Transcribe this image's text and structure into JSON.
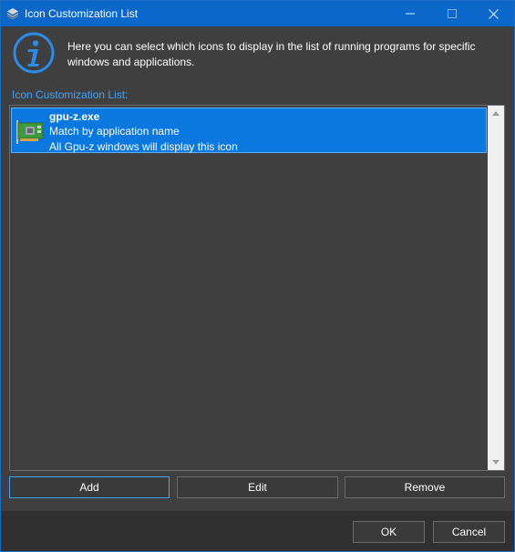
{
  "window": {
    "title": "Icon Customization List",
    "accent_color": "#0b67c9"
  },
  "info": {
    "icon": "info-icon",
    "text": "Here you can select which icons to display in the list of running programs for specific windows and applications."
  },
  "list": {
    "label": "Icon Customization List:",
    "items": [
      {
        "name": "gpu-z.exe",
        "match": "Match by application name",
        "description": "All Gpu-z windows will display this icon",
        "icon": "graphics-card-icon",
        "selected": true
      }
    ]
  },
  "buttons": {
    "add": "Add",
    "edit": "Edit",
    "remove": "Remove",
    "ok": "OK",
    "cancel": "Cancel"
  }
}
